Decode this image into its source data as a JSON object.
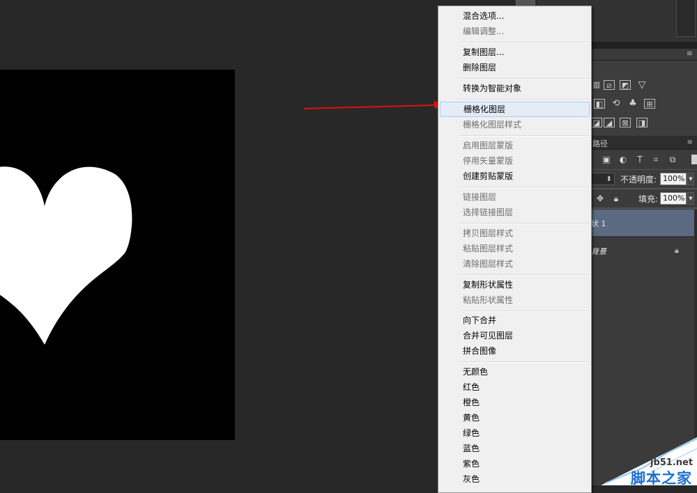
{
  "canvas": {
    "background": "#000000",
    "shape": "heart"
  },
  "context_menu": {
    "items": [
      {
        "label": "混合选项...",
        "disabled": false
      },
      {
        "label": "编辑调整...",
        "disabled": true
      },
      {
        "label": "复制图层...",
        "disabled": false
      },
      {
        "label": "删除图层",
        "disabled": false
      },
      {
        "label": "转换为智能对象",
        "disabled": false
      },
      {
        "label": "栅格化图层",
        "disabled": false,
        "hover": true
      },
      {
        "label": "栅格化图层样式",
        "disabled": true
      },
      {
        "label": "启用图层蒙版",
        "disabled": true
      },
      {
        "label": "停用矢量蒙版",
        "disabled": true
      },
      {
        "label": "创建剪贴蒙版",
        "disabled": false
      },
      {
        "label": "链接图层",
        "disabled": true
      },
      {
        "label": "选择链接图层",
        "disabled": true
      },
      {
        "label": "拷贝图层样式",
        "disabled": true
      },
      {
        "label": "粘贴图层样式",
        "disabled": true
      },
      {
        "label": "清除图层样式",
        "disabled": true
      },
      {
        "label": "复制形状属性",
        "disabled": false
      },
      {
        "label": "粘贴形状属性",
        "disabled": true
      },
      {
        "label": "向下合并",
        "disabled": false
      },
      {
        "label": "合并可见图层",
        "disabled": false
      },
      {
        "label": "拼合图像",
        "disabled": false
      },
      {
        "label": "无颜色",
        "disabled": false
      },
      {
        "label": "红色",
        "disabled": false
      },
      {
        "label": "橙色",
        "disabled": false
      },
      {
        "label": "黄色",
        "disabled": false
      },
      {
        "label": "绿色",
        "disabled": false
      },
      {
        "label": "蓝色",
        "disabled": false
      },
      {
        "label": "紫色",
        "disabled": false
      },
      {
        "label": "灰色",
        "disabled": false
      }
    ]
  },
  "layers_panel": {
    "tab_label": "路径",
    "opacity_label": "不透明度:",
    "opacity_value": "100%",
    "fill_label": "填充:",
    "fill_value": "100%",
    "layers": [
      {
        "name": "状 1",
        "selected": true
      },
      {
        "name": "背景",
        "locked": true
      }
    ]
  },
  "watermark": {
    "domain": "jb51.net",
    "name": "脚本之家"
  },
  "colors": {
    "arrow": "#e01010",
    "menu_hover": "#e4ecf7",
    "layer_selected": "#5b6a80"
  }
}
